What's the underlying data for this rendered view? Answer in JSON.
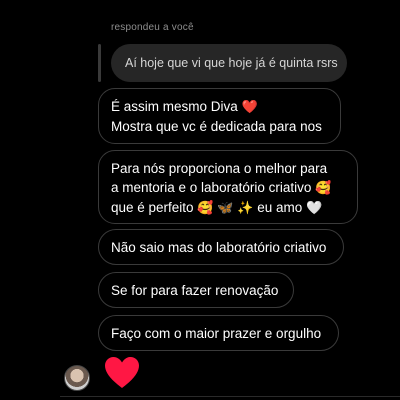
{
  "reply": {
    "label": "respondeu a você",
    "quoted_text": "Aí hoje que vi que hoje já é quinta rsrs"
  },
  "messages": [
    {
      "lines": [
        "É assim mesmo Diva",
        "Mostra que vc é dedicada para nos"
      ],
      "emoji_line1": "❤️"
    },
    {
      "lines": [
        "Para nós proporciona o melhor para",
        "a mentoria e o laboratório criativo",
        "que é perfeito"
      ],
      "emoji_line2": "🥰",
      "emoji_line3": [
        "🥰",
        "🦋",
        "✨"
      ],
      "tail_line3": "eu amo",
      "tail_emoji": "🤍"
    },
    {
      "lines": [
        "Não saio mas do laboratório criativo"
      ]
    },
    {
      "lines": [
        "Se for para fazer renovação"
      ]
    },
    {
      "lines": [
        "Faço com o maior prazer e orgulho"
      ]
    }
  ],
  "reaction": {
    "emoji_name": "heart-icon",
    "color": "#ff1744"
  },
  "colors": {
    "background": "#000000",
    "bubble_border": "#3a3a3a",
    "quoted_bg": "#262626",
    "muted_text": "#8e8e8e"
  }
}
